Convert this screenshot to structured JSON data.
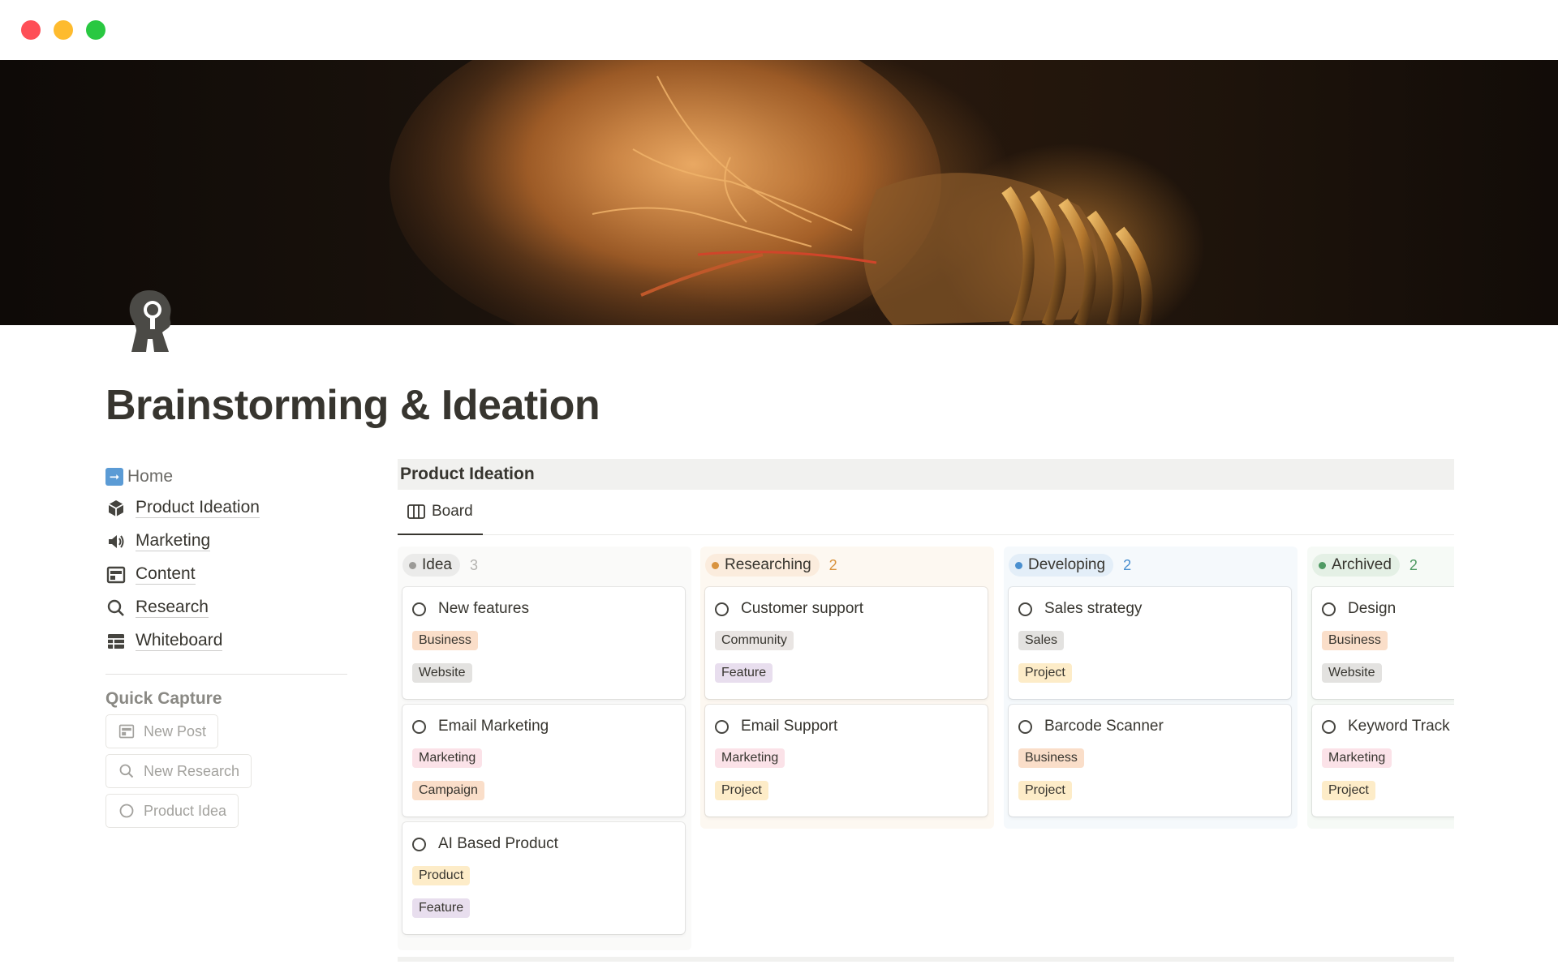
{
  "window": {
    "controls": [
      "close",
      "minimize",
      "maximize"
    ]
  },
  "page": {
    "title": "Brainstorming & Ideation",
    "cover": "light-bulb-photo",
    "icon": "head-with-lightbulb-icon"
  },
  "nav": {
    "items": [
      {
        "label": "Home",
        "icon": "arrow-right-icon"
      },
      {
        "label": "Product Ideation",
        "icon": "cube-icon"
      },
      {
        "label": "Marketing",
        "icon": "megaphone-icon"
      },
      {
        "label": "Content",
        "icon": "layout-icon"
      },
      {
        "label": "Research",
        "icon": "search-icon"
      },
      {
        "label": "Whiteboard",
        "icon": "table-icon"
      }
    ]
  },
  "quick_capture": {
    "title": "Quick Capture",
    "buttons": [
      {
        "label": "New Post",
        "icon": "layout-icon"
      },
      {
        "label": "New Research",
        "icon": "search-icon"
      },
      {
        "label": "Product Idea",
        "icon": "circle-icon"
      }
    ]
  },
  "database": {
    "title": "Product Ideation",
    "view_tab": "Board",
    "columns": [
      {
        "status": "Idea",
        "count": "3",
        "pill_bg": "#ebebea",
        "dot": "#9b9a97",
        "count_color": "#b4b3b0",
        "cards": [
          {
            "title": "New features",
            "tags": [
              "Business",
              "Website"
            ]
          },
          {
            "title": "Email Marketing",
            "tags": [
              "Marketing",
              "Campaign"
            ]
          },
          {
            "title": "AI Based Product",
            "tags": [
              "Product",
              "Feature"
            ]
          }
        ]
      },
      {
        "status": "Researching",
        "count": "2",
        "pill_bg": "#fbecdd",
        "dot": "#d9933e",
        "count_color": "#d9933e",
        "cards": [
          {
            "title": "Customer support",
            "tags": [
              "Community",
              "Feature"
            ]
          },
          {
            "title": "Email Support",
            "tags": [
              "Marketing",
              "Project"
            ]
          }
        ]
      },
      {
        "status": "Developing",
        "count": "2",
        "pill_bg": "#e3eef8",
        "dot": "#4a8fcf",
        "count_color": "#4a8fcf",
        "cards": [
          {
            "title": "Sales strategy",
            "tags": [
              "Sales",
              "Project"
            ]
          },
          {
            "title": "Barcode Scanner",
            "tags": [
              "Business",
              "Project"
            ]
          }
        ]
      },
      {
        "status": "Archived",
        "count": "2",
        "pill_bg": "#e4f0e5",
        "dot": "#4f9a63",
        "count_color": "#4f9a63",
        "cards": [
          {
            "title": "Design",
            "tags": [
              "Business",
              "Website"
            ]
          },
          {
            "title": "Keyword Track",
            "tags": [
              "Marketing",
              "Project"
            ]
          }
        ]
      }
    ],
    "tag_colors": {
      "Business": "#fadec9",
      "Website": "#e3e2e0",
      "Marketing": "#fbe2e8",
      "Campaign": "#fadec9",
      "Product": "#fdecc8",
      "Feature": "#e8deee",
      "Community": "#e9e5e3",
      "Project": "#fdecc8",
      "Sales": "#e3e2e0"
    }
  }
}
